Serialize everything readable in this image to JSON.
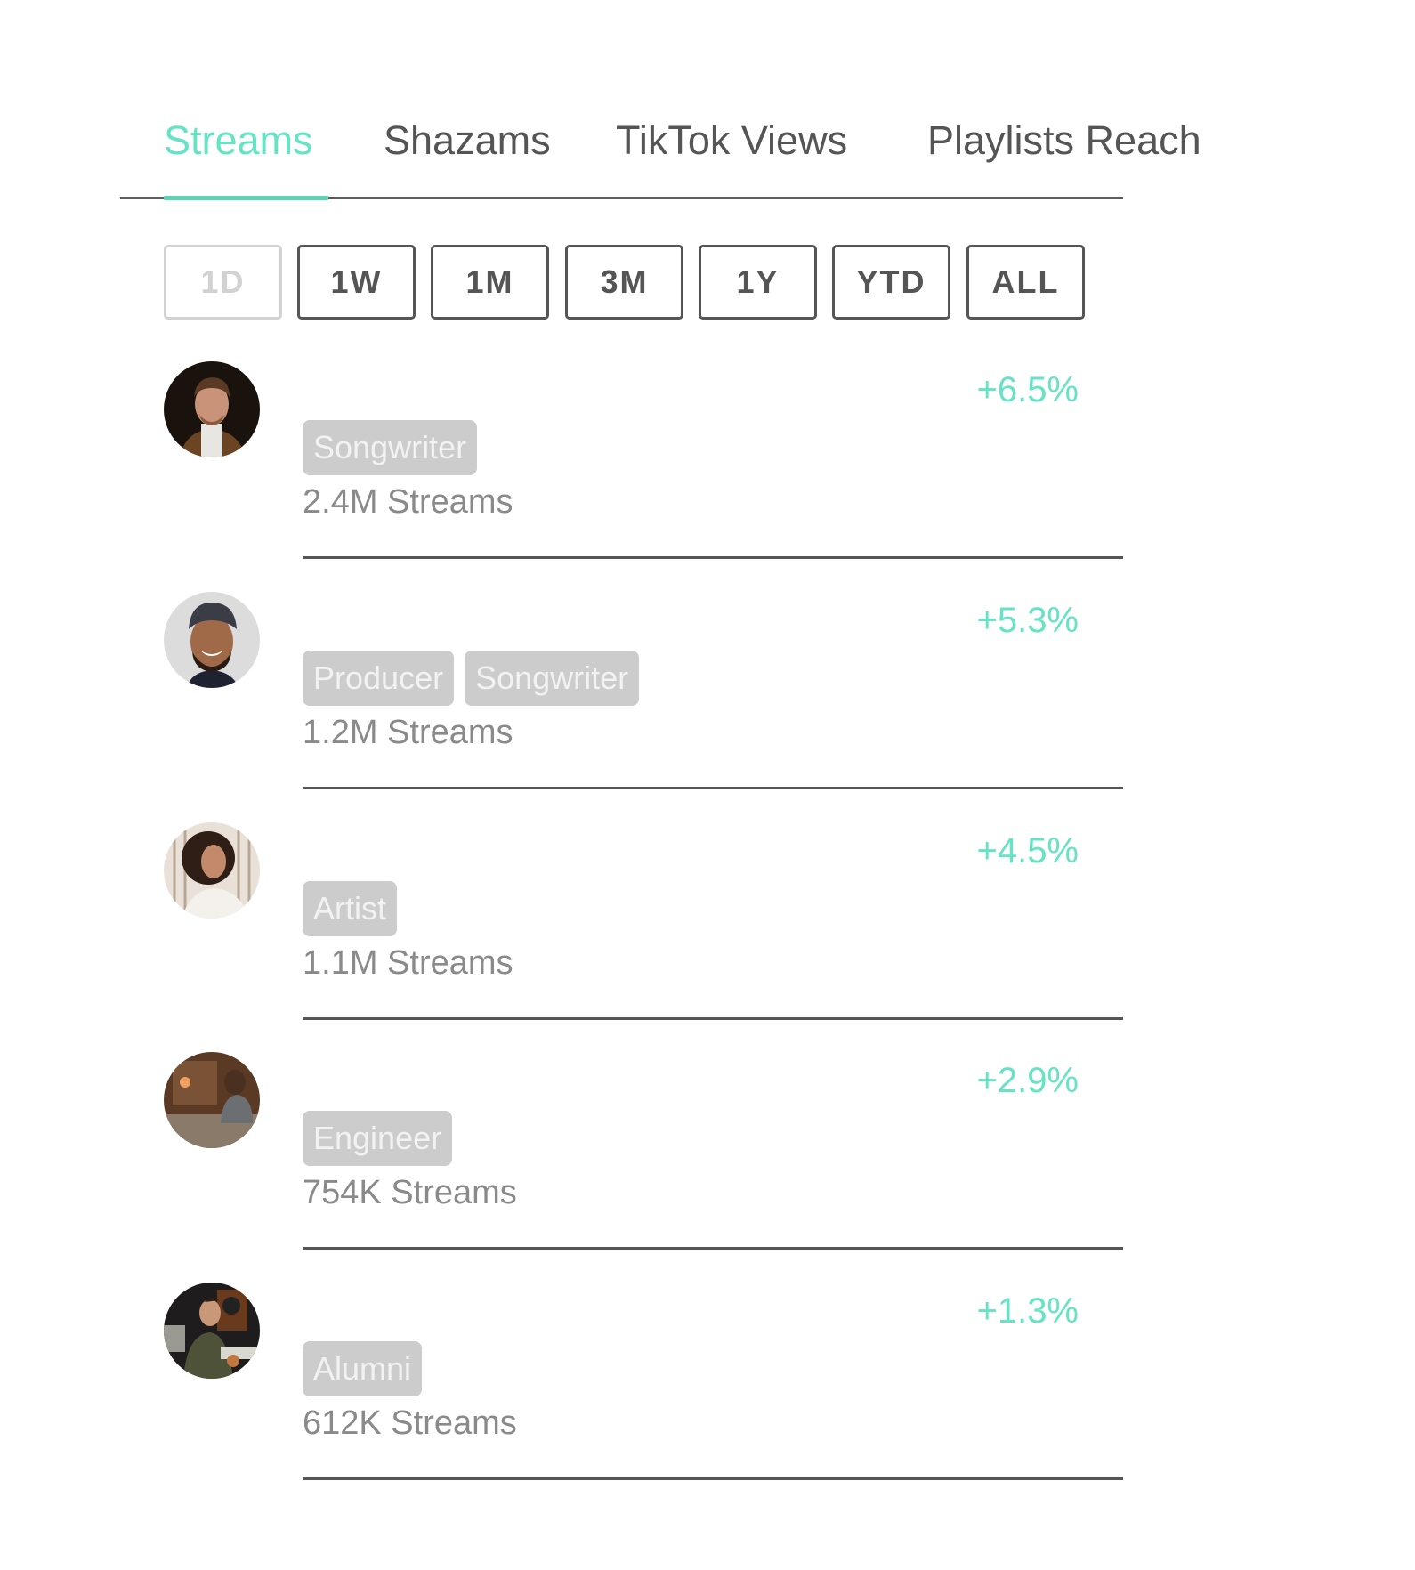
{
  "tabs": [
    {
      "label": "Streams",
      "active": true
    },
    {
      "label": "Shazams",
      "active": false
    },
    {
      "label": "TikTok Views",
      "active": false
    },
    {
      "label": "Playlists Reach",
      "active": false
    }
  ],
  "ranges": [
    {
      "label": "1D",
      "disabled": true
    },
    {
      "label": "1W",
      "disabled": false
    },
    {
      "label": "1M",
      "disabled": false
    },
    {
      "label": "3M",
      "disabled": false
    },
    {
      "label": "1Y",
      "disabled": false
    },
    {
      "label": "YTD",
      "disabled": false
    },
    {
      "label": "ALL",
      "disabled": false
    }
  ],
  "accent_color": "#66e3c4",
  "rows": [
    {
      "avatar": "man-turtleneck-portrait",
      "change": "+6.5%",
      "tags": [
        "Songwriter"
      ],
      "streams": "2.4M Streams"
    },
    {
      "avatar": "man-beanie-smiling-portrait",
      "change": "+5.3%",
      "tags": [
        "Producer",
        "Songwriter"
      ],
      "streams": "1.2M Streams"
    },
    {
      "avatar": "woman-curly-hair-portrait",
      "change": "+4.5%",
      "tags": [
        "Artist"
      ],
      "streams": "1.1M Streams"
    },
    {
      "avatar": "man-at-mixing-console",
      "change": "+2.9%",
      "tags": [
        "Engineer"
      ],
      "streams": "754K Streams"
    },
    {
      "avatar": "man-in-studio-jacket",
      "change": "+1.3%",
      "tags": [
        "Alumni"
      ],
      "streams": "612K Streams"
    }
  ]
}
